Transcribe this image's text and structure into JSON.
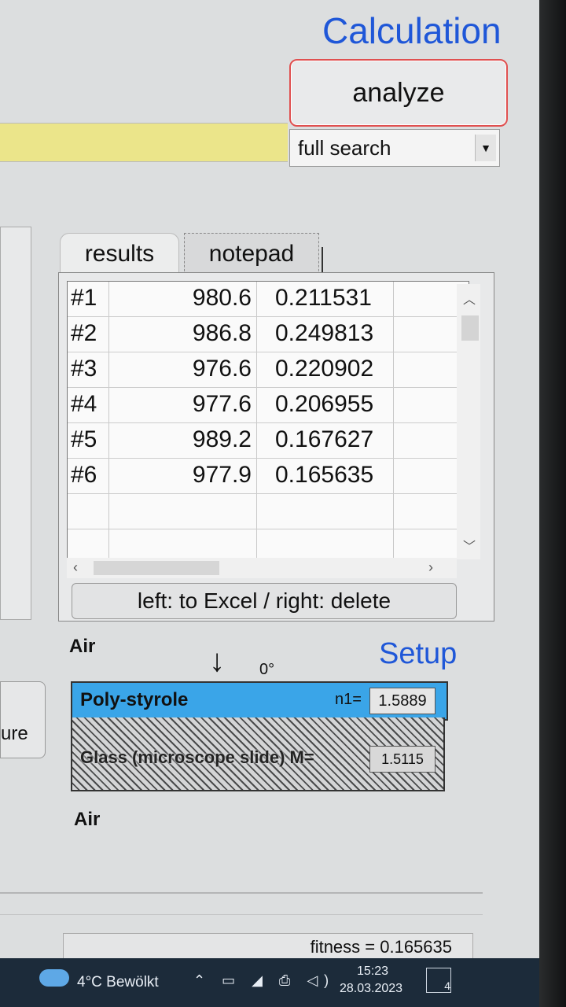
{
  "header": {
    "title": "Calculation",
    "analyze_label": "analyze",
    "search_mode": "full search"
  },
  "tabs": [
    {
      "label": "results"
    },
    {
      "label": "notepad"
    }
  ],
  "results": {
    "rows": [
      {
        "id": "#1",
        "value": "980.6",
        "fitness": "0.211531"
      },
      {
        "id": "#2",
        "value": "986.8",
        "fitness": "0.249813"
      },
      {
        "id": "#3",
        "value": "976.6",
        "fitness": "0.220902"
      },
      {
        "id": "#4",
        "value": "977.6",
        "fitness": "0.206955"
      },
      {
        "id": "#5",
        "value": "989.2",
        "fitness": "0.167627"
      },
      {
        "id": "#6",
        "value": "977.9",
        "fitness": "0.165635"
      }
    ],
    "action_label": "left: to Excel / right: delete"
  },
  "left_button_label": "ure",
  "setup": {
    "title": "Setup",
    "top_medium": "Air",
    "bottom_medium": "Air",
    "angle": "0°",
    "layers": [
      {
        "name": "Poly-styrole",
        "n_label": "n1=",
        "n_value": "1.5889",
        "color": "#3aa5e8"
      },
      {
        "name": "Glass (microscope slide) M=",
        "n_value": "1.5115"
      }
    ]
  },
  "status": {
    "fitness_text": "fitness = 0.165635"
  },
  "taskbar": {
    "weather": "4°C  Bewölkt",
    "time": "15:23",
    "date": "28.03.2023",
    "notification_count": "4"
  }
}
